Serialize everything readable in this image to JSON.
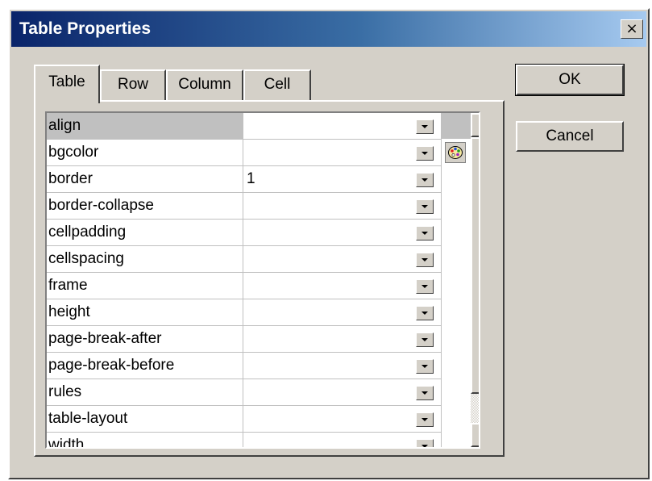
{
  "window": {
    "title": "Table Properties",
    "close_label": "×"
  },
  "tabs": [
    {
      "label": "Table",
      "active": true
    },
    {
      "label": "Row",
      "active": false
    },
    {
      "label": "Column",
      "active": false
    },
    {
      "label": "Cell",
      "active": false
    }
  ],
  "properties": [
    {
      "name": "align",
      "value": "",
      "selected": true
    },
    {
      "name": "bgcolor",
      "value": "",
      "icon": "color-palette-icon"
    },
    {
      "name": "border",
      "value": "1"
    },
    {
      "name": "border-collapse",
      "value": ""
    },
    {
      "name": "cellpadding",
      "value": ""
    },
    {
      "name": "cellspacing",
      "value": ""
    },
    {
      "name": "frame",
      "value": ""
    },
    {
      "name": "height",
      "value": ""
    },
    {
      "name": "page-break-after",
      "value": ""
    },
    {
      "name": "page-break-before",
      "value": ""
    },
    {
      "name": "rules",
      "value": ""
    },
    {
      "name": "table-layout",
      "value": ""
    },
    {
      "name": "width",
      "value": ""
    }
  ],
  "buttons": {
    "ok": "OK",
    "cancel": "Cancel"
  },
  "colors": {
    "face": "#d4d0c8",
    "titlebar_start": "#0a246a",
    "titlebar_end": "#a6caf0"
  }
}
